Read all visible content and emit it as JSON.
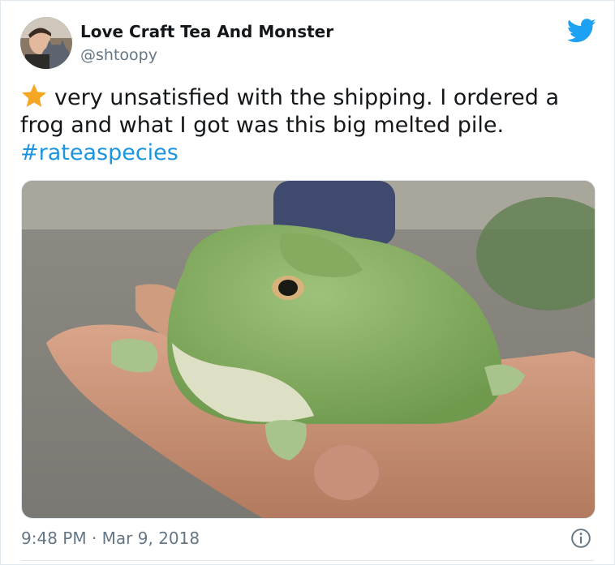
{
  "tweet": {
    "author": {
      "display_name": "Love Craft Tea And Monster",
      "handle": "@shtoopy"
    },
    "text": {
      "line1": "very unsatisfied with the shipping. I ordered a",
      "line2": "frog and what I got was this big melted pile.",
      "hashtag": "#rateaspecies"
    },
    "timestamp": "9:48 PM · Mar 9, 2018",
    "icons": {
      "platform": "twitter-bird-icon",
      "rating": "star-emoji-icon",
      "info": "info-icon"
    },
    "colors": {
      "brand": "#1da1f2",
      "link": "#1b95e0",
      "muted": "#657786",
      "star": "#f5a623"
    }
  }
}
